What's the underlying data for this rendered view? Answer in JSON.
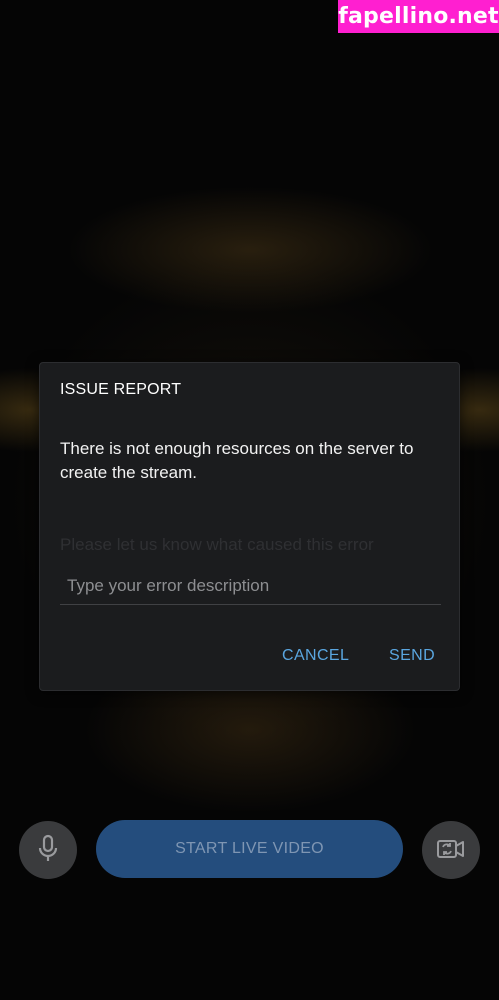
{
  "watermark": {
    "text": "fapellino.net",
    "color": "#ff1fd0"
  },
  "dialog": {
    "title": "ISSUE REPORT",
    "message": "There is not enough resources on the server to create the stream.",
    "field_label": "Please let us know what caused this error",
    "input_placeholder": "Type your error description",
    "input_value": "",
    "cancel_label": "CANCEL",
    "send_label": "SEND",
    "accent_color": "#5aa6e0"
  },
  "controls": {
    "start_label": "START LIVE VIDEO",
    "start_color": "#244d7d",
    "mic_icon": "microphone-icon",
    "flip_icon": "switch-camera-icon"
  }
}
